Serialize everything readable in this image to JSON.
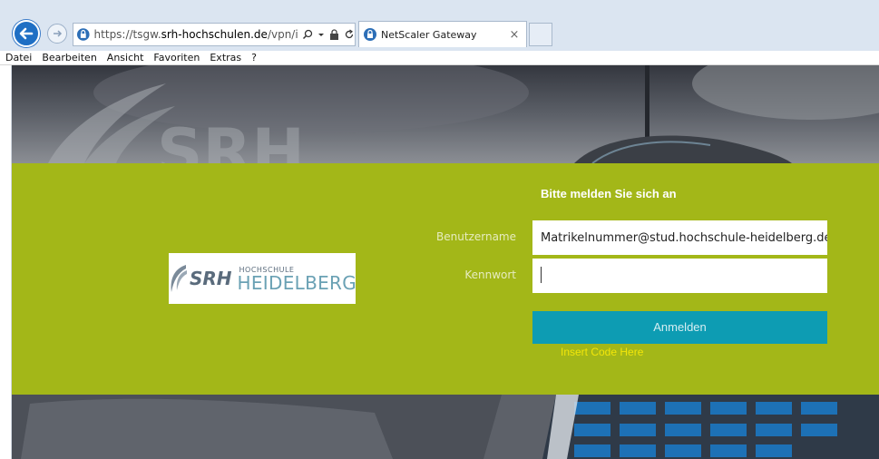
{
  "browser": {
    "url_prefix": "https://tsgw.",
    "url_domain": "srh-hochschulen.de",
    "url_path": "/vpn/index.h",
    "tab_title": "NetScaler Gateway",
    "tab_close": "×",
    "menu": [
      "Datei",
      "Bearbeiten",
      "Ansicht",
      "Favoriten",
      "Extras",
      "?"
    ],
    "icons": {
      "back": "back-arrow-icon",
      "forward": "forward-arrow-icon",
      "site": "citrix-site-icon",
      "search": "search-icon",
      "lock": "lock-icon",
      "refresh": "refresh-icon"
    }
  },
  "logo": {
    "srh": "SRH",
    "hochschule": "HOCHSCHULE",
    "heidelberg": "HEIDELBERG"
  },
  "login": {
    "heading": "Bitte melden Sie sich an",
    "username_label": "Benutzername",
    "username_value": "Matrikelnummer@stud.hochschule-heidelberg.de",
    "password_label": "Kennwort",
    "password_value": "",
    "submit_label": "Anmelden",
    "insert_code": "Insert Code Here"
  },
  "colors": {
    "band": "#a3b718",
    "button": "#0d9cb3",
    "insert_text": "#f2e60a",
    "browser_back": "#1f6fc4"
  }
}
